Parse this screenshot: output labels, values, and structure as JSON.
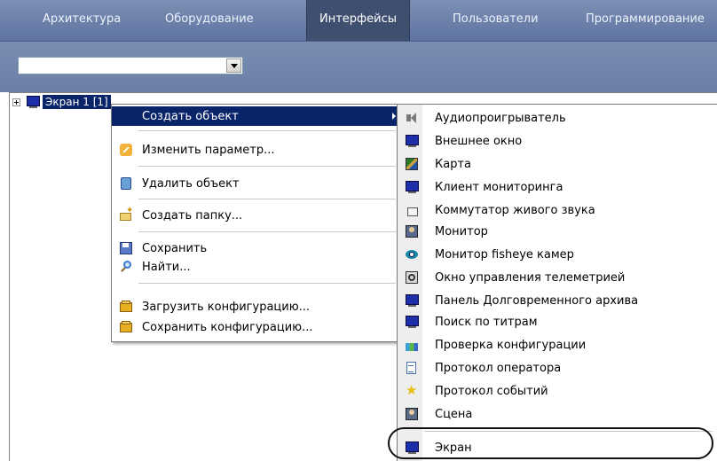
{
  "tabs": [
    {
      "label": "Архитектура",
      "active": false
    },
    {
      "label": "Оборудование",
      "active": false
    },
    {
      "label": "Интерфейсы",
      "active": true
    },
    {
      "label": "Пользователи",
      "active": false
    },
    {
      "label": "Программирование",
      "active": false
    }
  ],
  "toolbar": {
    "combo_value": ""
  },
  "tree": {
    "node_label": "Экран 1 [1]"
  },
  "context_menu": {
    "items": [
      {
        "label": "Создать объект",
        "icon": "none",
        "highlighted": true,
        "has_submenu": true
      },
      {
        "label": "Изменить параметр...",
        "icon": "pencil-icon"
      },
      {
        "label": "Удалить объект",
        "icon": "delete-icon"
      },
      {
        "label": "Создать папку...",
        "icon": "new-folder-icon"
      },
      {
        "label": "Сохранить",
        "icon": "save-icon"
      },
      {
        "label": "Найти...",
        "icon": "find-icon"
      },
      {
        "label": "Загрузить конфигурацию...",
        "icon": "load-config-icon"
      },
      {
        "label": "Сохранить конфигурацию...",
        "icon": "save-config-icon"
      }
    ]
  },
  "submenu": {
    "items": [
      {
        "label": "Аудиопроигрыватель",
        "icon": "speaker-icon"
      },
      {
        "label": "Внешнее окно",
        "icon": "monitor-icon"
      },
      {
        "label": "Карта",
        "icon": "map-icon"
      },
      {
        "label": "Клиент мониторинга",
        "icon": "monitor-icon"
      },
      {
        "label": "Коммутатор живого звука",
        "icon": "box-icon"
      },
      {
        "label": "Монитор",
        "icon": "person-icon"
      },
      {
        "label": "Монитор fisheye камер",
        "icon": "eye-icon"
      },
      {
        "label": "Окно управления телеметрией",
        "icon": "ptz-icon"
      },
      {
        "label": "Панель Долговременного архива",
        "icon": "monitor-icon"
      },
      {
        "label": "Поиск по титрам",
        "icon": "monitor-icon"
      },
      {
        "label": "Проверка конфигурации",
        "icon": "check-config-icon"
      },
      {
        "label": "Протокол оператора",
        "icon": "document-icon"
      },
      {
        "label": "Протокол событий",
        "icon": "star-icon"
      },
      {
        "label": "Сцена",
        "icon": "person-icon"
      },
      {
        "label": "Экран",
        "icon": "monitor-icon",
        "circled": true
      }
    ]
  },
  "colors": {
    "tab_bar": "#6f82ab",
    "active_tab": "#3f4f70",
    "menu_highlight": "#0a246a"
  }
}
